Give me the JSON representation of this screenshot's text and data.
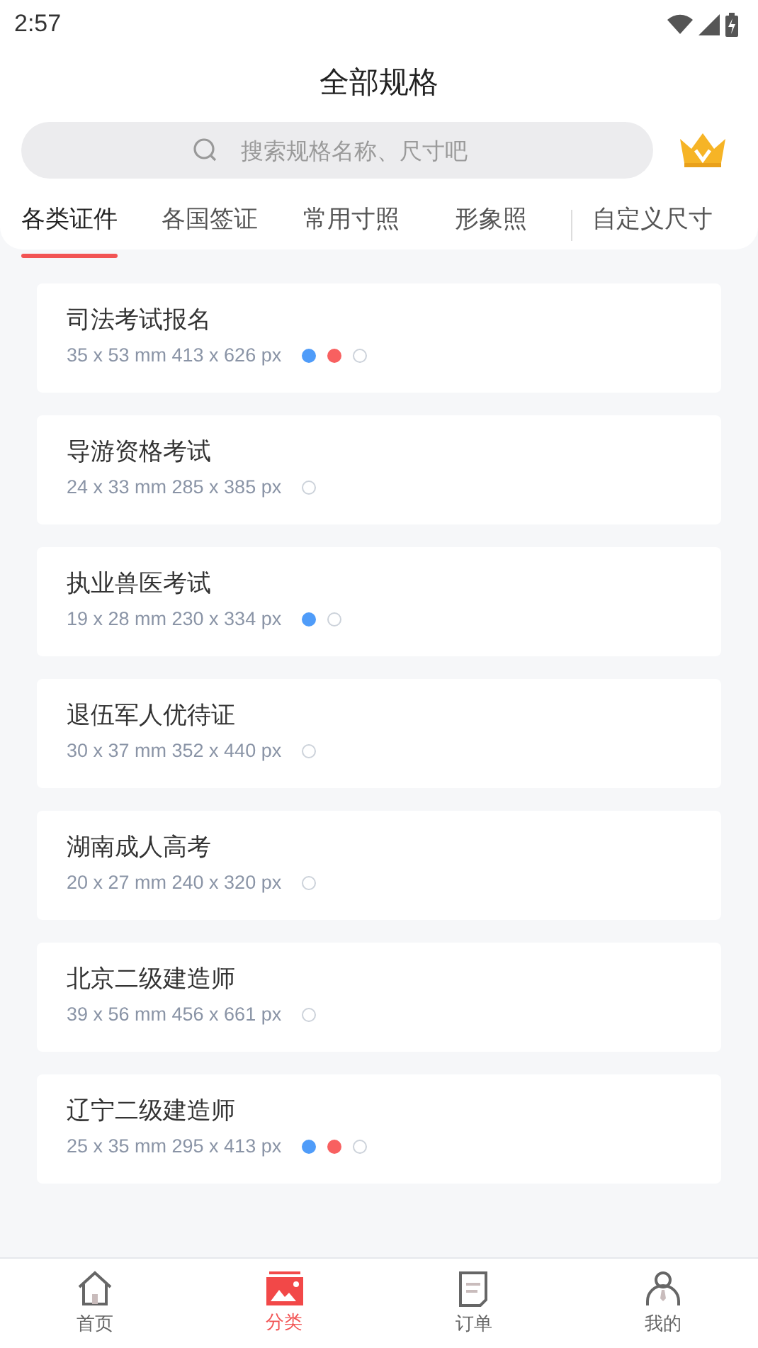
{
  "status_bar": {
    "time": "2:57"
  },
  "header": {
    "title": "全部规格"
  },
  "search": {
    "placeholder": "搜索规格名称、尺寸吧"
  },
  "tabs": [
    {
      "label": "各类证件",
      "selected": true
    },
    {
      "label": "各国签证",
      "selected": false
    },
    {
      "label": "常用寸照",
      "selected": false
    },
    {
      "label": "形象照",
      "selected": false
    },
    {
      "label": "自定义尺寸",
      "selected": false
    }
  ],
  "specs": [
    {
      "name": "司法考试报名",
      "size": "35 x 53 mm 413 x 626 px",
      "backgrounds": [
        {
          "color": "#4f9cf9"
        },
        {
          "color": "#f86060"
        },
        {
          "color": "#ffffff"
        }
      ]
    },
    {
      "name": "导游资格考试",
      "size": "24 x 33 mm 285 x 385 px",
      "backgrounds": [
        {
          "color": "#ffffff"
        }
      ]
    },
    {
      "name": "执业兽医考试",
      "size": "19 x 28 mm 230 x 334 px",
      "backgrounds": [
        {
          "color": "#4f9cf9"
        },
        {
          "color": "#ffffff"
        }
      ]
    },
    {
      "name": "退伍军人优待证",
      "size": "30 x 37 mm 352 x 440 px",
      "backgrounds": [
        {
          "color": "#ffffff"
        }
      ]
    },
    {
      "name": "湖南成人高考",
      "size": "20 x 27 mm 240 x 320 px",
      "backgrounds": [
        {
          "color": "#ffffff"
        }
      ]
    },
    {
      "name": "北京二级建造师",
      "size": "39 x 56 mm 456 x 661 px",
      "backgrounds": [
        {
          "color": "#ffffff"
        }
      ]
    },
    {
      "name": "辽宁二级建造师",
      "size": "25 x 35 mm 295 x 413 px",
      "backgrounds": [
        {
          "color": "#4f9cf9"
        },
        {
          "color": "#f86060"
        },
        {
          "color": "#ffffff"
        }
      ]
    }
  ],
  "bottom_nav": [
    {
      "label": "首页",
      "kind": "home",
      "selected": false
    },
    {
      "label": "分类",
      "kind": "category",
      "selected": true
    },
    {
      "label": "订单",
      "kind": "order",
      "selected": false
    },
    {
      "label": "我的",
      "kind": "profile",
      "selected": false
    }
  ]
}
